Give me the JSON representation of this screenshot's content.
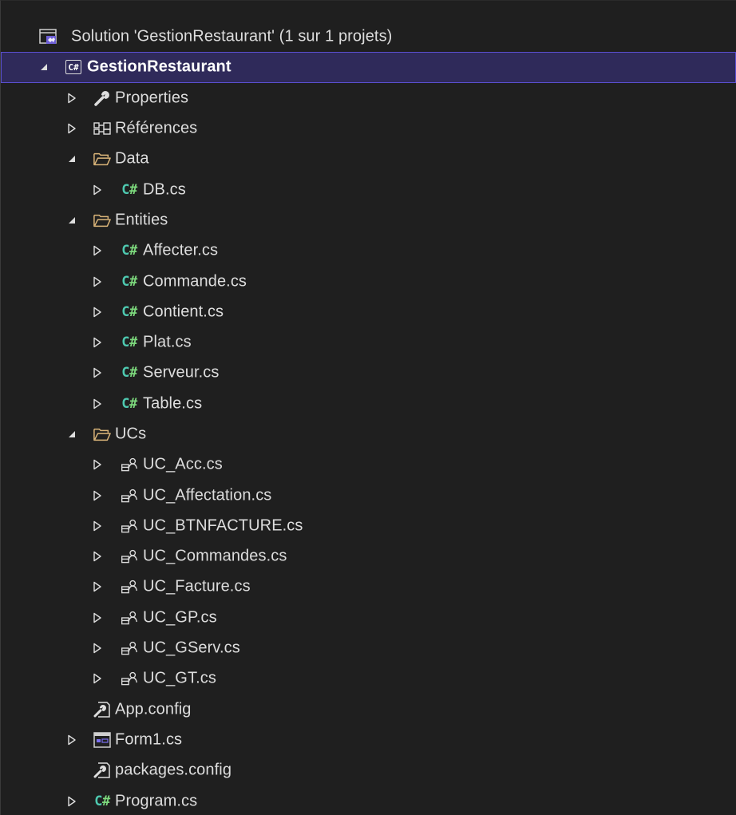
{
  "solution": {
    "label": "Solution 'GestionRestaurant' (1 sur 1 projets)",
    "icon": "solution-icon"
  },
  "colors": {
    "background": "#1f1f1f",
    "selection": "#2f2a5a",
    "selection_border": "#5a4fd0",
    "csharp_glyph": "#4ec9b0",
    "folder": "#dcb67a",
    "text": "#dddddd"
  },
  "rows": [
    {
      "name": "project-gestionrestaurant",
      "label": "GestionRestaurant",
      "icon": "csharp-project-icon",
      "indent": 1,
      "expander": "expanded",
      "selected": true
    },
    {
      "name": "node-properties",
      "label": "Properties",
      "icon": "wrench-icon",
      "indent": 2,
      "expander": "collapsed"
    },
    {
      "name": "node-references",
      "label": "Références",
      "icon": "references-icon",
      "indent": 2,
      "expander": "collapsed"
    },
    {
      "name": "folder-data",
      "label": "Data",
      "icon": "folder-open-icon",
      "indent": 2,
      "expander": "expanded"
    },
    {
      "name": "file-db",
      "label": "DB.cs",
      "icon": "csharp-file-icon",
      "indent": 3,
      "expander": "collapsed"
    },
    {
      "name": "folder-entities",
      "label": "Entities",
      "icon": "folder-open-icon",
      "indent": 2,
      "expander": "expanded"
    },
    {
      "name": "file-affecter",
      "label": "Affecter.cs",
      "icon": "csharp-file-icon",
      "indent": 3,
      "expander": "collapsed"
    },
    {
      "name": "file-commande",
      "label": "Commande.cs",
      "icon": "csharp-file-icon",
      "indent": 3,
      "expander": "collapsed"
    },
    {
      "name": "file-contient",
      "label": "Contient.cs",
      "icon": "csharp-file-icon",
      "indent": 3,
      "expander": "collapsed"
    },
    {
      "name": "file-plat",
      "label": "Plat.cs",
      "icon": "csharp-file-icon",
      "indent": 3,
      "expander": "collapsed"
    },
    {
      "name": "file-serveur",
      "label": "Serveur.cs",
      "icon": "csharp-file-icon",
      "indent": 3,
      "expander": "collapsed"
    },
    {
      "name": "file-table",
      "label": "Table.cs",
      "icon": "csharp-file-icon",
      "indent": 3,
      "expander": "collapsed"
    },
    {
      "name": "folder-ucs",
      "label": "UCs",
      "icon": "folder-open-icon",
      "indent": 2,
      "expander": "expanded"
    },
    {
      "name": "file-uc-acc",
      "label": "UC_Acc.cs",
      "icon": "user-control-icon",
      "indent": 3,
      "expander": "collapsed"
    },
    {
      "name": "file-uc-affectation",
      "label": "UC_Affectation.cs",
      "icon": "user-control-icon",
      "indent": 3,
      "expander": "collapsed"
    },
    {
      "name": "file-uc-btnfacture",
      "label": "UC_BTNFACTURE.cs",
      "icon": "user-control-icon",
      "indent": 3,
      "expander": "collapsed"
    },
    {
      "name": "file-uc-commandes",
      "label": "UC_Commandes.cs",
      "icon": "user-control-icon",
      "indent": 3,
      "expander": "collapsed"
    },
    {
      "name": "file-uc-facture",
      "label": "UC_Facture.cs",
      "icon": "user-control-icon",
      "indent": 3,
      "expander": "collapsed"
    },
    {
      "name": "file-uc-gp",
      "label": "UC_GP.cs",
      "icon": "user-control-icon",
      "indent": 3,
      "expander": "collapsed"
    },
    {
      "name": "file-uc-gserv",
      "label": "UC_GServ.cs",
      "icon": "user-control-icon",
      "indent": 3,
      "expander": "collapsed"
    },
    {
      "name": "file-uc-gt",
      "label": "UC_GT.cs",
      "icon": "user-control-icon",
      "indent": 3,
      "expander": "collapsed"
    },
    {
      "name": "file-app-config",
      "label": "App.config",
      "icon": "config-file-icon",
      "indent": 2,
      "expander": "none"
    },
    {
      "name": "file-form1",
      "label": "Form1.cs",
      "icon": "form-icon",
      "indent": 2,
      "expander": "collapsed"
    },
    {
      "name": "file-packages-config",
      "label": "packages.config",
      "icon": "config-file-icon",
      "indent": 2,
      "expander": "none"
    },
    {
      "name": "file-program",
      "label": "Program.cs",
      "icon": "csharp-file-icon",
      "indent": 2,
      "expander": "collapsed"
    }
  ]
}
